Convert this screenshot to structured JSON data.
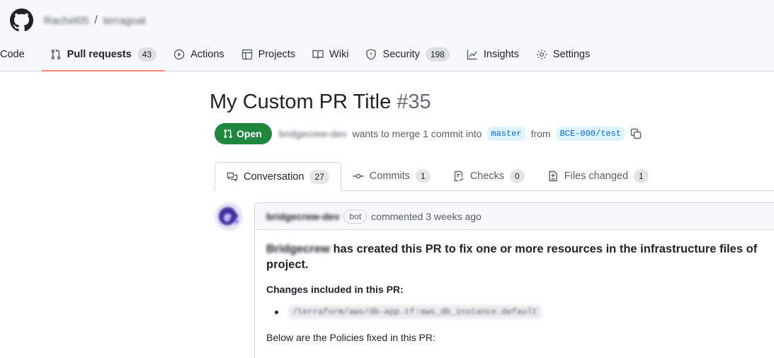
{
  "header": {
    "owner": "Rachel05",
    "separator": "/",
    "repo": "terragoat"
  },
  "nav": [
    {
      "label": "Code",
      "icon": "code-icon",
      "counter": null
    },
    {
      "label": "Pull requests",
      "icon": "git-pull-request-icon",
      "counter": "43",
      "active": true
    },
    {
      "label": "Actions",
      "icon": "play-icon",
      "counter": null
    },
    {
      "label": "Projects",
      "icon": "table-icon",
      "counter": null
    },
    {
      "label": "Wiki",
      "icon": "book-icon",
      "counter": null
    },
    {
      "label": "Security",
      "icon": "shield-icon",
      "counter": "198"
    },
    {
      "label": "Insights",
      "icon": "graph-icon",
      "counter": null
    },
    {
      "label": "Settings",
      "icon": "gear-icon",
      "counter": null
    }
  ],
  "pr": {
    "title": "My Custom PR Title",
    "number": "#35",
    "state": "Open",
    "author": "bridgecrew-dev",
    "merge_text": "wants to merge 1 commit into",
    "base_branch": "master",
    "from_text": "from",
    "head_branch": "BCE-000/test"
  },
  "tabs": [
    {
      "label": "Conversation",
      "counter": "27",
      "icon": "comment-discussion-icon"
    },
    {
      "label": "Commits",
      "counter": "1",
      "icon": "git-commit-icon"
    },
    {
      "label": "Checks",
      "counter": "0",
      "icon": "checklist-icon"
    },
    {
      "label": "Files changed",
      "counter": "1",
      "icon": "file-diff-icon"
    }
  ],
  "comment": {
    "author": "bridgecrew-dev",
    "badge": "bot",
    "meta": "commented 3 weeks ago",
    "lead_brand": "Bridgecrew",
    "lead_text": " has created this PR to fix one or more resources in the infrastructure files of",
    "lead_text2": "project.",
    "changes_heading": "Changes included in this PR:",
    "change_item": "/terraform/aws/db-app.tf:aws_db_instance.default",
    "policies_line": "Below are the Policies fixed in this PR:"
  },
  "colors": {
    "open_green": "#1f883d",
    "accent_underline": "#fd8c73",
    "branch_bg": "#ddf4ff",
    "branch_fg": "#0969da"
  }
}
